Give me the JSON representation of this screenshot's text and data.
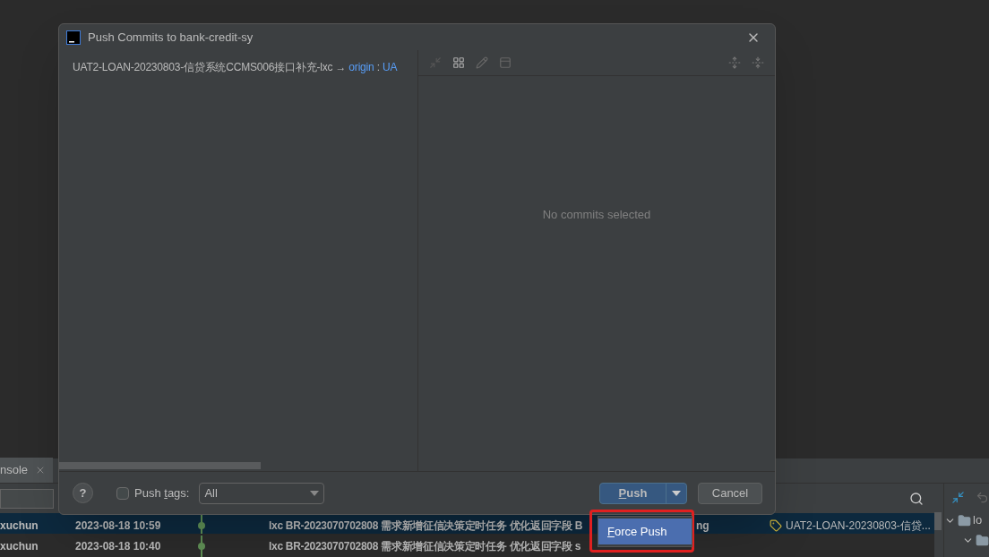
{
  "tool_window": {
    "tab": {
      "label": "nsole",
      "selected": true
    },
    "rows": [
      {
        "author": "xuchun",
        "date": "2023-08-18 10:59",
        "message": "lxc BR-2023070702808 需求新增征信决策定时任务 优化返回字段 B",
        "message_tail": "ng",
        "tag": "UAT2-LOAN-20230803-信贷...",
        "selected": true
      },
      {
        "author": "xuchun",
        "date": "2023-08-18 10:40",
        "message": "lxc BR-2023070702808 需求新增征信决策定时任务 优化返回字段 s",
        "selected": false
      }
    ],
    "tree": [
      {
        "label": "lo",
        "expanded": true
      },
      {
        "expanded": true
      }
    ]
  },
  "dialog": {
    "title": "Push Commits to bank-credit-sy",
    "branch": {
      "local": "UAT2-LOAN-20230803-信贷系统CCMS006接口补充-lxc",
      "arrow": "→",
      "remote": "origin",
      "separator": ":",
      "target": "UA"
    },
    "empty_message": "No commits selected",
    "help": "?",
    "push_tags": {
      "before": "Push ",
      "mnemonic": "t",
      "after": "ags:",
      "checked": false
    },
    "tags_select": {
      "value": "All"
    },
    "push_button": {
      "mnemonic": "P",
      "after": "ush"
    },
    "cancel_button": {
      "label": "Cancel"
    },
    "menu": [
      {
        "mnemonic": "F",
        "after": "orce Push",
        "selected": true
      }
    ]
  }
}
